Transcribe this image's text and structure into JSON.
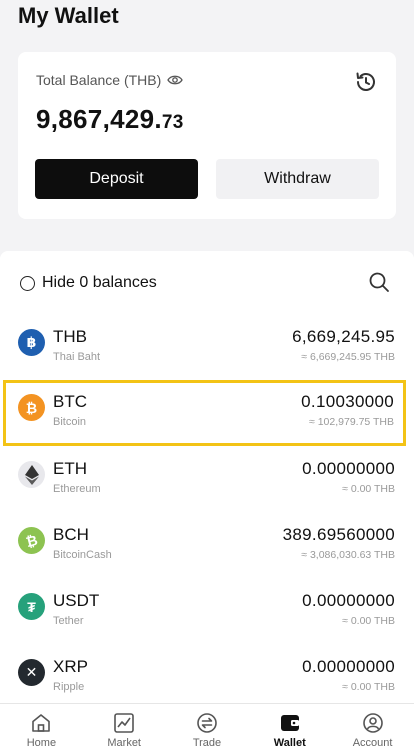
{
  "header": {
    "title": "My Wallet"
  },
  "balance": {
    "label": "Total Balance (THB)",
    "amount_main": "9,867,429.",
    "amount_decimal": "73",
    "deposit_label": "Deposit",
    "withdraw_label": "Withdraw"
  },
  "filter": {
    "hide_label": "Hide 0 balances"
  },
  "coins": [
    {
      "symbol": "THB",
      "name": "Thai Baht",
      "amount": "6,669,245.95",
      "value": "≈ 6,669,245.95 THB",
      "icon": "baht-icon",
      "color": "#1f5fb0",
      "glyph": "฿"
    },
    {
      "symbol": "BTC",
      "name": "Bitcoin",
      "amount": "0.10030000",
      "value": "≈ 102,979.75 THB",
      "icon": "bitcoin-icon",
      "color": "#f39322",
      "glyph": "₿"
    },
    {
      "symbol": "ETH",
      "name": "Ethereum",
      "amount": "0.00000000",
      "value": "≈ 0.00 THB",
      "icon": "ethereum-icon",
      "color": "#e8e8ec",
      "glyph": "◆"
    },
    {
      "symbol": "BCH",
      "name": "BitcoinCash",
      "amount": "389.69560000",
      "value": "≈ 3,086,030.63 THB",
      "icon": "bitcoincash-icon",
      "color": "#8dc351",
      "glyph": "₿"
    },
    {
      "symbol": "USDT",
      "name": "Tether",
      "amount": "0.00000000",
      "value": "≈ 0.00 THB",
      "icon": "tether-icon",
      "color": "#26a17b",
      "glyph": "₮"
    },
    {
      "symbol": "XRP",
      "name": "Ripple",
      "amount": "0.00000000",
      "value": "≈ 0.00 THB",
      "icon": "ripple-icon",
      "color": "#23292f",
      "glyph": "✕"
    }
  ],
  "nav": {
    "home": "Home",
    "market": "Market",
    "trade": "Trade",
    "wallet": "Wallet",
    "account": "Account"
  },
  "colors": {
    "highlight": "#f3c316",
    "primary_button": "#0d0d0d"
  }
}
